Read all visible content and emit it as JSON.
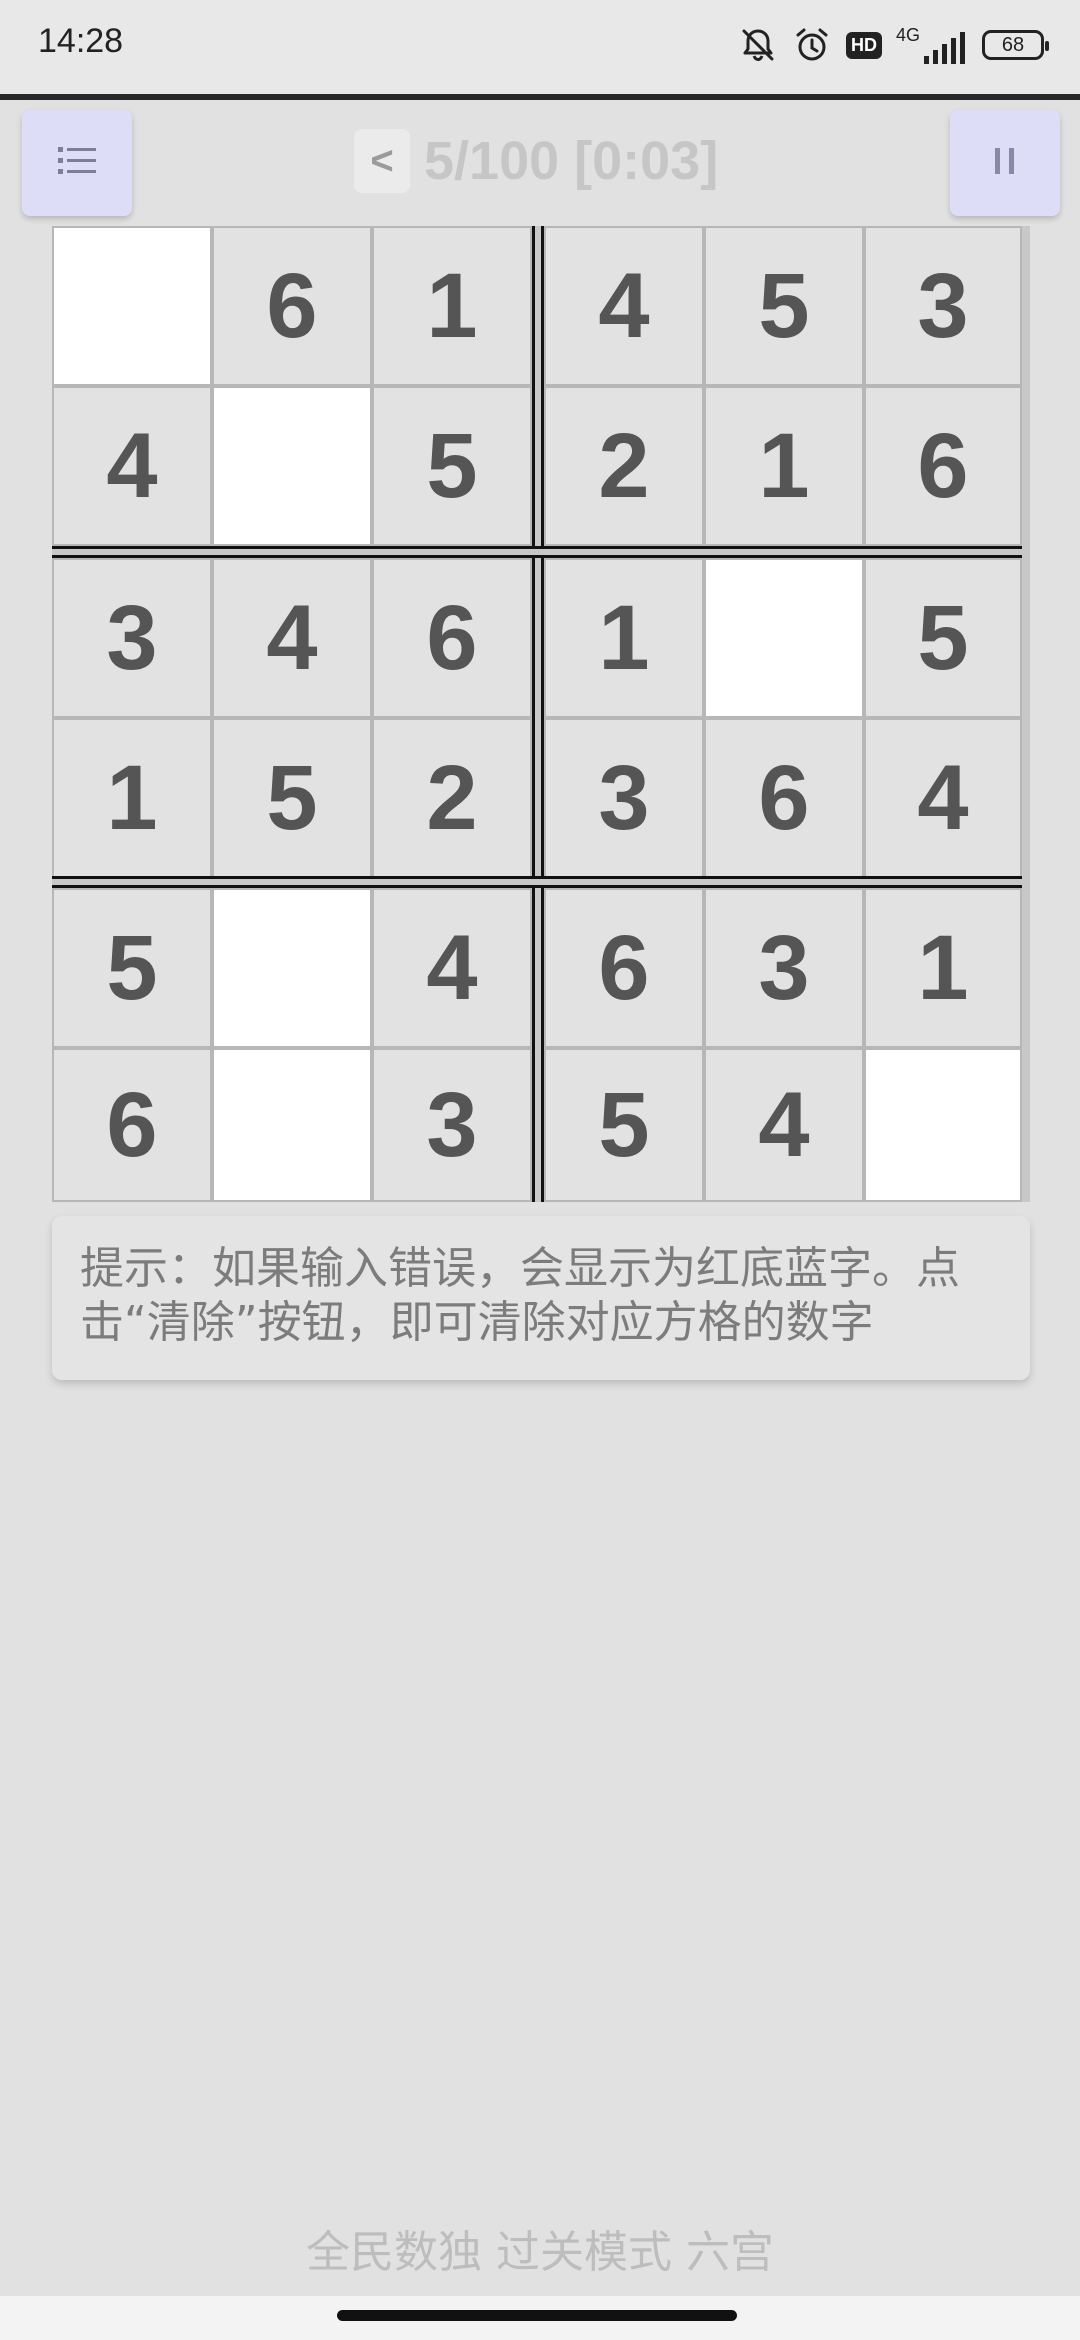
{
  "status_bar": {
    "time": "14:28",
    "hd_label": "HD",
    "network_label": "4G",
    "battery_level": "68",
    "icons": [
      "bell-off-icon",
      "alarm-icon",
      "hd-icon",
      "signal-icon",
      "battery-icon"
    ]
  },
  "toolbar": {
    "menu_icon": "list-icon",
    "back_label": "<",
    "level_title": "5/100 [0:03]",
    "pause_icon": "pause-icon"
  },
  "board": {
    "size": 6,
    "box_rows": 2,
    "box_cols": 3,
    "cells": [
      [
        "",
        "6",
        "1",
        "4",
        "5",
        "3"
      ],
      [
        "4",
        "",
        "5",
        "2",
        "1",
        "6"
      ],
      [
        "3",
        "4",
        "6",
        "1",
        "",
        "5"
      ],
      [
        "1",
        "5",
        "2",
        "3",
        "6",
        "4"
      ],
      [
        "5",
        "",
        "4",
        "6",
        "3",
        "1"
      ],
      [
        "6",
        "",
        "3",
        "5",
        "4",
        ""
      ]
    ]
  },
  "hint": {
    "text": "提示：如果输入错误，会显示为红底蓝字。点击“清除”按钮，即可清除对应方格的数字"
  },
  "footer": {
    "text": "全民数独 过关模式 六宫"
  },
  "colors": {
    "background": "#e1e1e1",
    "given_cell": "#e2e2e2",
    "empty_cell": "#ffffff",
    "digit": "#555555",
    "button_bg": "#ddddf8"
  }
}
